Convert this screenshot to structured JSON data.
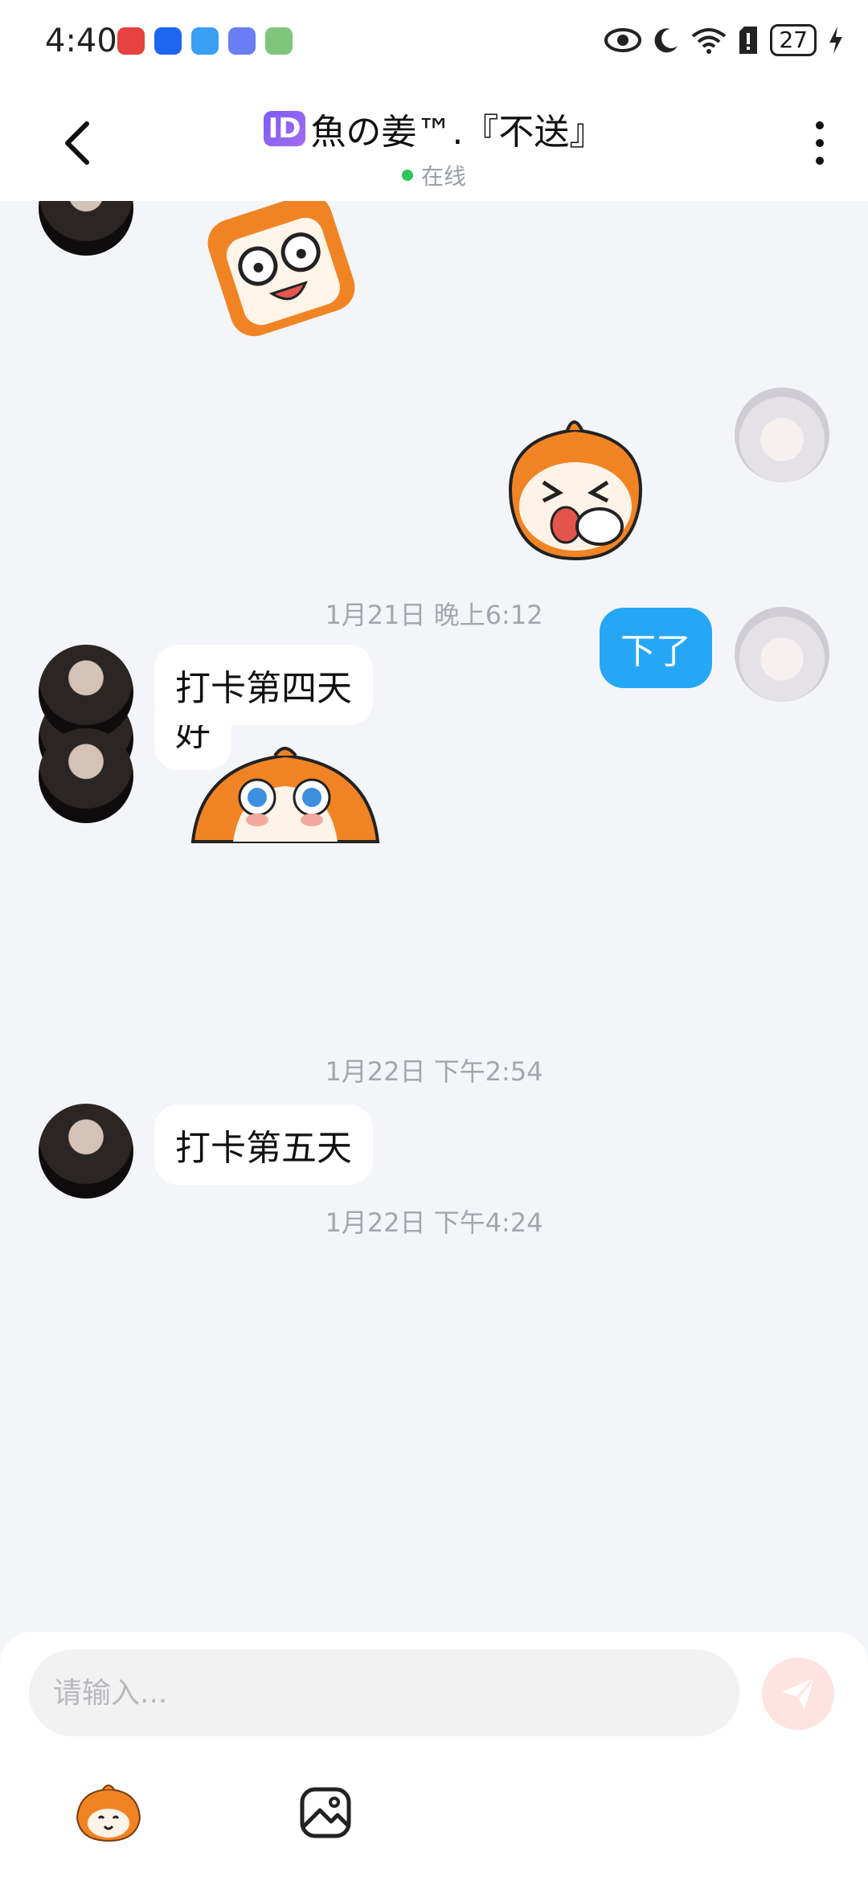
{
  "status_bar": {
    "time": "4:40",
    "battery": "27"
  },
  "header": {
    "id_badge": "ID",
    "title": "魚の姜™.『不送』",
    "status": "在线"
  },
  "messages": [
    {
      "type": "sticker",
      "side": "left",
      "sticker": "glasses-face-sticker"
    },
    {
      "type": "sticker",
      "side": "right",
      "sticker": "laughing-pointing-sticker"
    },
    {
      "type": "text",
      "side": "right",
      "text": "下了"
    },
    {
      "type": "text",
      "side": "left",
      "text": "好"
    },
    {
      "type": "time",
      "text": "1月21日 晚上6:12"
    },
    {
      "type": "text",
      "side": "left",
      "text": "打卡第四天"
    },
    {
      "type": "sticker",
      "side": "left",
      "sticker": "teary-eyes-sticker"
    },
    {
      "type": "time",
      "text": "1月22日 下午2:54"
    },
    {
      "type": "text",
      "side": "left",
      "text": "打卡第五天"
    },
    {
      "type": "time",
      "text": "1月22日 下午4:24"
    }
  ],
  "input": {
    "placeholder": "请输入..."
  },
  "toolbar": {
    "emoji": "emoji-sticker-icon",
    "image": "image-icon"
  },
  "colors": {
    "my_bubble": "#26a7f5",
    "online_dot": "#2fc55a",
    "send_button": "#fde3e1"
  }
}
